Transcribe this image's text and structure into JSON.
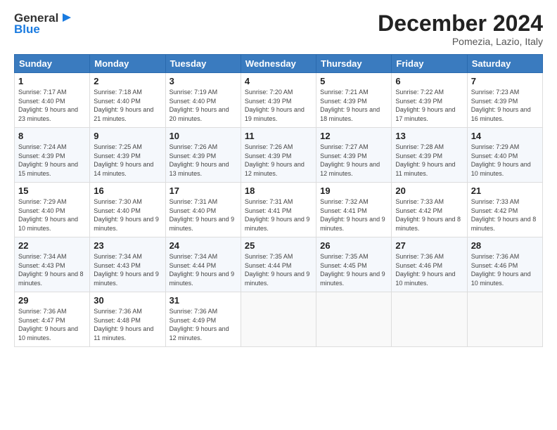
{
  "logo": {
    "text_general": "General",
    "text_blue": "Blue"
  },
  "header": {
    "month": "December 2024",
    "location": "Pomezia, Lazio, Italy"
  },
  "weekdays": [
    "Sunday",
    "Monday",
    "Tuesday",
    "Wednesday",
    "Thursday",
    "Friday",
    "Saturday"
  ],
  "weeks": [
    [
      {
        "day": "1",
        "sunrise": "7:17 AM",
        "sunset": "4:40 PM",
        "daylight": "9 hours and 23 minutes."
      },
      {
        "day": "2",
        "sunrise": "7:18 AM",
        "sunset": "4:40 PM",
        "daylight": "9 hours and 21 minutes."
      },
      {
        "day": "3",
        "sunrise": "7:19 AM",
        "sunset": "4:40 PM",
        "daylight": "9 hours and 20 minutes."
      },
      {
        "day": "4",
        "sunrise": "7:20 AM",
        "sunset": "4:39 PM",
        "daylight": "9 hours and 19 minutes."
      },
      {
        "day": "5",
        "sunrise": "7:21 AM",
        "sunset": "4:39 PM",
        "daylight": "9 hours and 18 minutes."
      },
      {
        "day": "6",
        "sunrise": "7:22 AM",
        "sunset": "4:39 PM",
        "daylight": "9 hours and 17 minutes."
      },
      {
        "day": "7",
        "sunrise": "7:23 AM",
        "sunset": "4:39 PM",
        "daylight": "9 hours and 16 minutes."
      }
    ],
    [
      {
        "day": "8",
        "sunrise": "7:24 AM",
        "sunset": "4:39 PM",
        "daylight": "9 hours and 15 minutes."
      },
      {
        "day": "9",
        "sunrise": "7:25 AM",
        "sunset": "4:39 PM",
        "daylight": "9 hours and 14 minutes."
      },
      {
        "day": "10",
        "sunrise": "7:26 AM",
        "sunset": "4:39 PM",
        "daylight": "9 hours and 13 minutes."
      },
      {
        "day": "11",
        "sunrise": "7:26 AM",
        "sunset": "4:39 PM",
        "daylight": "9 hours and 12 minutes."
      },
      {
        "day": "12",
        "sunrise": "7:27 AM",
        "sunset": "4:39 PM",
        "daylight": "9 hours and 12 minutes."
      },
      {
        "day": "13",
        "sunrise": "7:28 AM",
        "sunset": "4:39 PM",
        "daylight": "9 hours and 11 minutes."
      },
      {
        "day": "14",
        "sunrise": "7:29 AM",
        "sunset": "4:40 PM",
        "daylight": "9 hours and 10 minutes."
      }
    ],
    [
      {
        "day": "15",
        "sunrise": "7:29 AM",
        "sunset": "4:40 PM",
        "daylight": "9 hours and 10 minutes."
      },
      {
        "day": "16",
        "sunrise": "7:30 AM",
        "sunset": "4:40 PM",
        "daylight": "9 hours and 9 minutes."
      },
      {
        "day": "17",
        "sunrise": "7:31 AM",
        "sunset": "4:40 PM",
        "daylight": "9 hours and 9 minutes."
      },
      {
        "day": "18",
        "sunrise": "7:31 AM",
        "sunset": "4:41 PM",
        "daylight": "9 hours and 9 minutes."
      },
      {
        "day": "19",
        "sunrise": "7:32 AM",
        "sunset": "4:41 PM",
        "daylight": "9 hours and 9 minutes."
      },
      {
        "day": "20",
        "sunrise": "7:33 AM",
        "sunset": "4:42 PM",
        "daylight": "9 hours and 8 minutes."
      },
      {
        "day": "21",
        "sunrise": "7:33 AM",
        "sunset": "4:42 PM",
        "daylight": "9 hours and 8 minutes."
      }
    ],
    [
      {
        "day": "22",
        "sunrise": "7:34 AM",
        "sunset": "4:43 PM",
        "daylight": "9 hours and 8 minutes."
      },
      {
        "day": "23",
        "sunrise": "7:34 AM",
        "sunset": "4:43 PM",
        "daylight": "9 hours and 9 minutes."
      },
      {
        "day": "24",
        "sunrise": "7:34 AM",
        "sunset": "4:44 PM",
        "daylight": "9 hours and 9 minutes."
      },
      {
        "day": "25",
        "sunrise": "7:35 AM",
        "sunset": "4:44 PM",
        "daylight": "9 hours and 9 minutes."
      },
      {
        "day": "26",
        "sunrise": "7:35 AM",
        "sunset": "4:45 PM",
        "daylight": "9 hours and 9 minutes."
      },
      {
        "day": "27",
        "sunrise": "7:36 AM",
        "sunset": "4:46 PM",
        "daylight": "9 hours and 10 minutes."
      },
      {
        "day": "28",
        "sunrise": "7:36 AM",
        "sunset": "4:46 PM",
        "daylight": "9 hours and 10 minutes."
      }
    ],
    [
      {
        "day": "29",
        "sunrise": "7:36 AM",
        "sunset": "4:47 PM",
        "daylight": "9 hours and 10 minutes."
      },
      {
        "day": "30",
        "sunrise": "7:36 AM",
        "sunset": "4:48 PM",
        "daylight": "9 hours and 11 minutes."
      },
      {
        "day": "31",
        "sunrise": "7:36 AM",
        "sunset": "4:49 PM",
        "daylight": "9 hours and 12 minutes."
      },
      null,
      null,
      null,
      null
    ]
  ],
  "labels": {
    "sunrise": "Sunrise:",
    "sunset": "Sunset:",
    "daylight": "Daylight:"
  }
}
